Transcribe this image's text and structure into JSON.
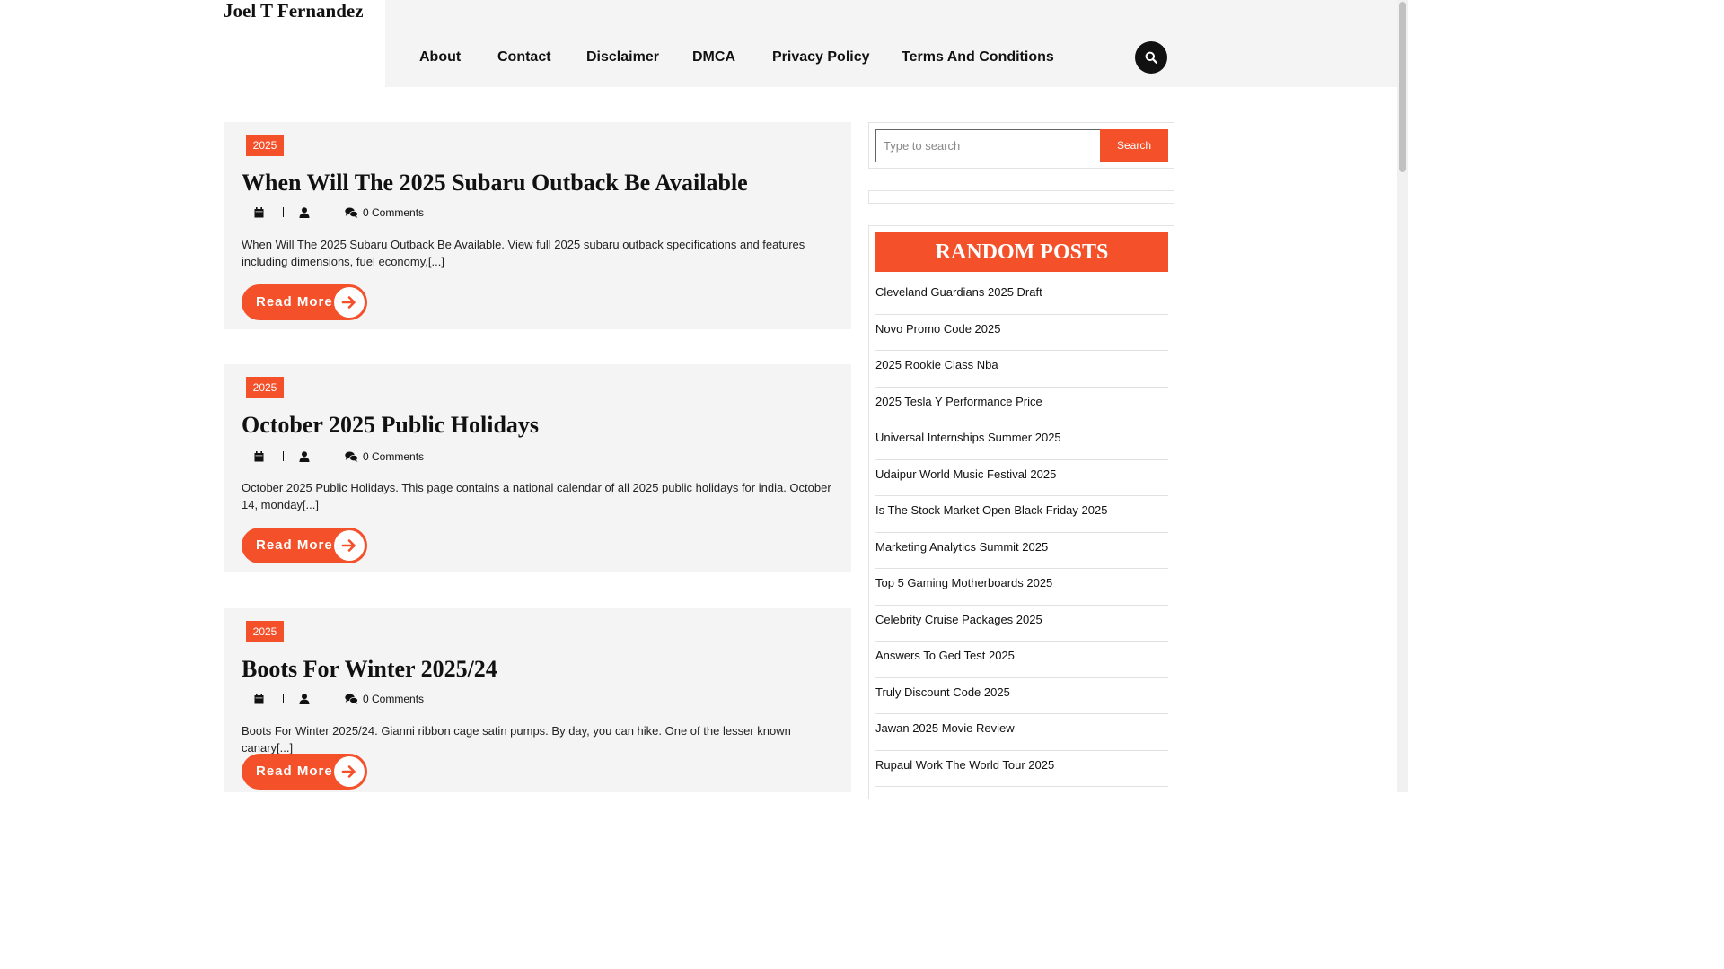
{
  "site": {
    "title": "Joel T Fernandez"
  },
  "nav": {
    "items": [
      {
        "label": "About"
      },
      {
        "label": "Contact"
      },
      {
        "label": "Disclaimer"
      },
      {
        "label": "DMCA"
      },
      {
        "label": "Privacy Policy"
      },
      {
        "label": "Terms And Conditions"
      }
    ],
    "search_icon": "search-icon"
  },
  "posts": [
    {
      "category": "2025",
      "title": "When Will The 2025 Subaru Outback Be Available",
      "comments": "0 Comments",
      "excerpt": "When Will The 2025 Subaru Outback Be Available. View full 2025 subaru outback specifications and features including dimensions, fuel economy,[...]",
      "read_more": "Read More"
    },
    {
      "category": "2025",
      "title": "October 2025 Public Holidays",
      "comments": "0 Comments",
      "excerpt": "October 2025 Public Holidays. This page contains a national calendar of all 2025 public holidays for india. October 14, monday[...]",
      "read_more": "Read More"
    },
    {
      "category": "2025",
      "title": "Boots For Winter 2025/24",
      "comments": "0 Comments",
      "excerpt": "Boots For Winter 2025/24. Gianni ribbon cage satin pumps. By day, you can hike. One of the lesser known canary[...]",
      "read_more": "Read More"
    }
  ],
  "sidebar": {
    "search": {
      "placeholder": "Type to search",
      "button_label": "Search"
    },
    "random_posts": {
      "heading": "RANDOM POSTS",
      "items": [
        "Cleveland Guardians 2025 Draft",
        "Novo Promo Code 2025",
        "2025 Rookie Class Nba",
        "2025 Tesla Y Performance Price",
        "Universal Internships Summer 2025",
        "Udaipur World Music Festival 2025",
        "Is The Stock Market Open Black Friday 2025",
        "Marketing Analytics Summit 2025",
        "Top 5 Gaming Motherboards 2025",
        "Celebrity Cruise Packages 2025",
        "Answers To Ged Test 2025",
        "Truly Discount Code 2025",
        "Jawan 2025 Movie Review",
        "Rupaul Work The World Tour 2025"
      ]
    }
  },
  "colors": {
    "accent": "#f4502a",
    "header_bg": "#f4f4f4",
    "card_bg": "#f4f4f4",
    "text": "#111111"
  }
}
